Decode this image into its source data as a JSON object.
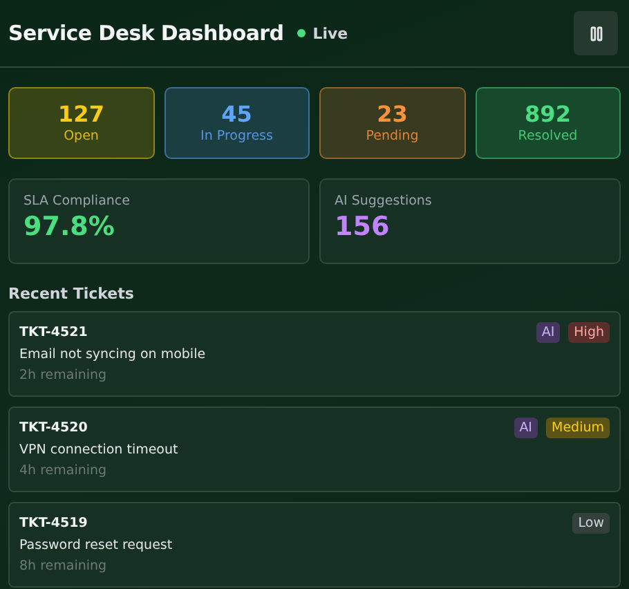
{
  "header": {
    "title": "Service Desk Dashboard",
    "status": "Live",
    "live": true,
    "paused": false
  },
  "stats": [
    {
      "value": "127",
      "label": "Open",
      "color": "#facc15"
    },
    {
      "value": "45",
      "label": "In Progress",
      "color": "#60a5fa"
    },
    {
      "value": "23",
      "label": "Pending",
      "color": "#fb923c"
    },
    {
      "value": "892",
      "label": "Resolved",
      "color": "#4ade80"
    }
  ],
  "metrics": [
    {
      "label": "SLA Compliance",
      "value": "97.8%",
      "color": "#4ade80"
    },
    {
      "label": "AI Suggestions",
      "value": "156",
      "color": "#c084fc"
    }
  ],
  "tickets_title": "Recent Tickets",
  "tickets": [
    {
      "id": "TKT-4521",
      "subject": "Email not syncing on mobile",
      "remaining": "2h remaining",
      "ai": "AI",
      "priority": "High",
      "kind": "high"
    },
    {
      "id": "TKT-4520",
      "subject": "VPN connection timeout",
      "remaining": "4h remaining",
      "ai": "AI",
      "priority": "Medium",
      "kind": "medium"
    },
    {
      "id": "TKT-4519",
      "subject": "Password reset request",
      "remaining": "8h remaining",
      "priority": "Low",
      "kind": "low"
    }
  ]
}
